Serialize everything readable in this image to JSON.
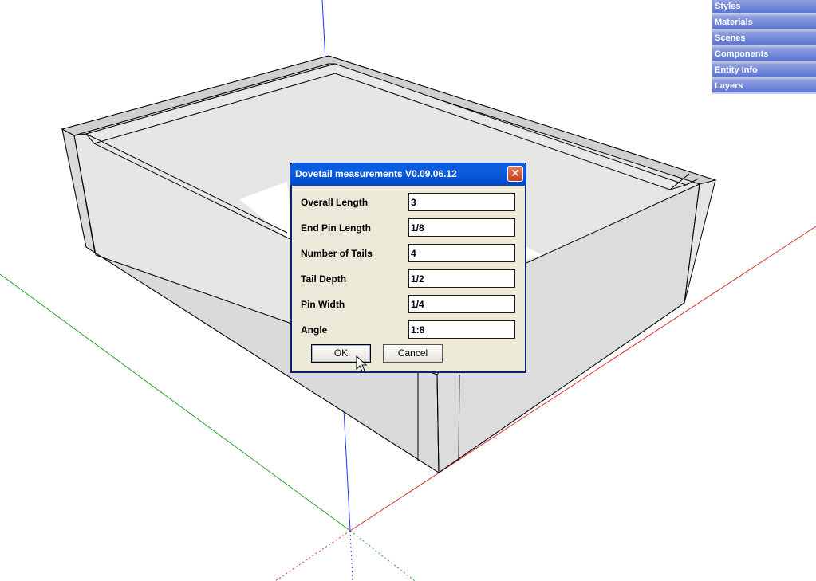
{
  "tray": {
    "items": [
      "Styles",
      "Materials",
      "Scenes",
      "Components",
      "Entity Info",
      "Layers"
    ]
  },
  "dialog": {
    "title": "Dovetail measurements V0.09.06.12",
    "close_icon": "close-icon",
    "fields": [
      {
        "label": "Overall Length",
        "value": "3"
      },
      {
        "label": "End Pin Length",
        "value": "1/8"
      },
      {
        "label": "Number of Tails",
        "value": "4"
      },
      {
        "label": "Tail Depth",
        "value": "1/2"
      },
      {
        "label": "Pin Width",
        "value": "1/4"
      },
      {
        "label": "Angle",
        "value": "1:8"
      }
    ],
    "ok_label": "OK",
    "cancel_label": "Cancel"
  },
  "colors": {
    "blue_axis": "#1a1aff",
    "red_axis": "#e02020",
    "green_axis": "#20a020",
    "model_face": "#e4e4e4",
    "titlebar": "#0a5fe4"
  }
}
